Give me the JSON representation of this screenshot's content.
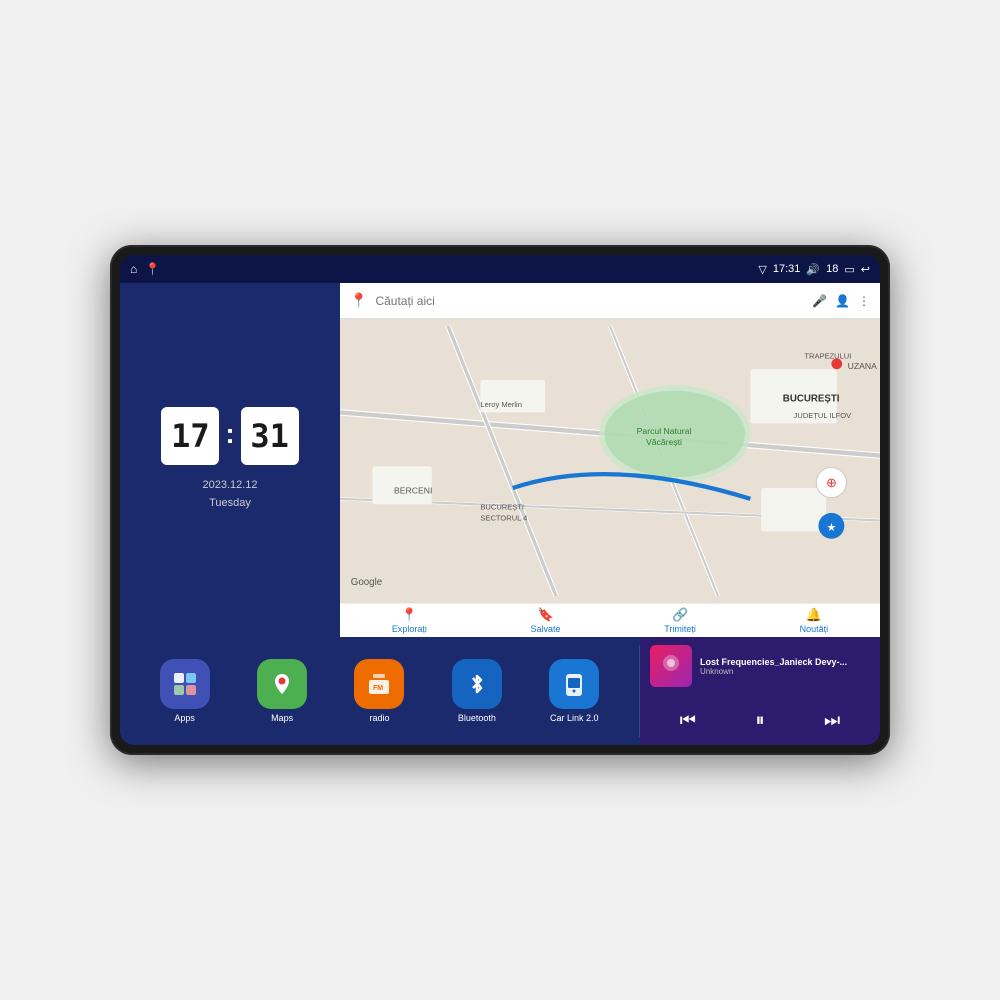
{
  "device": {
    "status_bar": {
      "time": "17:31",
      "signal_icon": "▽",
      "volume_icon": "🔊",
      "volume_level": "18",
      "battery_icon": "▭",
      "back_icon": "↩"
    },
    "nav_icons": [
      "⌂",
      "📍"
    ]
  },
  "clock": {
    "hour": "17",
    "minute": "31",
    "date": "2023.12.12",
    "day": "Tuesday"
  },
  "map": {
    "search_placeholder": "Căutați aici",
    "location": "București",
    "nav_items": [
      {
        "icon": "📍",
        "label": "Explorați"
      },
      {
        "icon": "🔖",
        "label": "Salvate"
      },
      {
        "icon": "🔗",
        "label": "Trimiteți"
      },
      {
        "icon": "🔔",
        "label": "Noutăți"
      }
    ]
  },
  "apps": [
    {
      "id": "apps",
      "label": "Apps",
      "icon": "⊞",
      "bg_class": "icon-apps"
    },
    {
      "id": "maps",
      "label": "Maps",
      "icon": "🗺",
      "bg_class": "icon-maps"
    },
    {
      "id": "radio",
      "label": "radio",
      "icon": "📻",
      "bg_class": "icon-radio"
    },
    {
      "id": "bluetooth",
      "label": "Bluetooth",
      "icon": "🔷",
      "bg_class": "icon-bluetooth"
    },
    {
      "id": "carlink",
      "label": "Car Link 2.0",
      "icon": "📱",
      "bg_class": "icon-carlink"
    }
  ],
  "music": {
    "title": "Lost Frequencies_Janieck Devy-...",
    "artist": "Unknown",
    "prev_label": "⏮",
    "play_label": "⏸",
    "next_label": "⏭"
  }
}
